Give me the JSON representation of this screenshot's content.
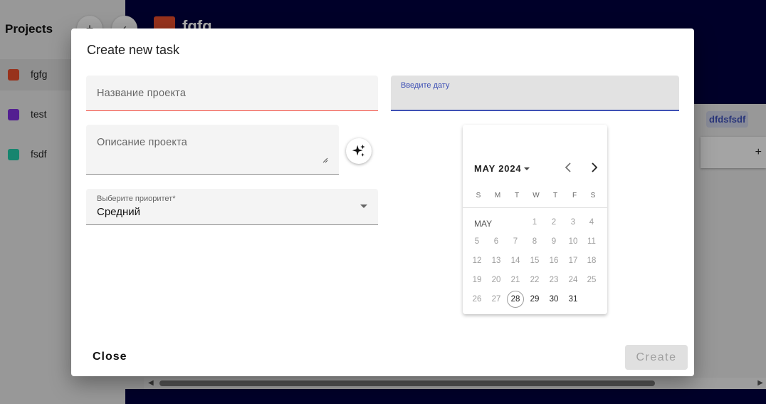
{
  "sidebar": {
    "title": "Projects",
    "add_icon": "+",
    "collapse_icon": "‹",
    "projects": [
      {
        "name": "fgfg",
        "color": "#e04a2a"
      },
      {
        "name": "test",
        "color": "#7b2fd6"
      },
      {
        "name": "fsdf",
        "color": "#23c4a4"
      }
    ]
  },
  "header": {
    "project_name": "fgfg",
    "logo_color": "#e04a2a"
  },
  "board": {
    "column_title": "dfdsfsdf",
    "add_card_icon": "+"
  },
  "dialog": {
    "title": "Create new task",
    "name_field": {
      "placeholder": "Название проекта"
    },
    "description_field": {
      "placeholder": "Описание проекта"
    },
    "ai_icon": "sparkles-icon",
    "priority_field": {
      "label": "Выберите приоритет*",
      "value": "Средний"
    },
    "date_field": {
      "label": "Введите дату"
    },
    "close_label": "Close",
    "create_label": "Create"
  },
  "calendar": {
    "period_label": "MAY 2024",
    "month_label": "MAY",
    "weekdays": [
      "S",
      "M",
      "T",
      "W",
      "T",
      "F",
      "S"
    ],
    "days": [
      "1",
      "2",
      "3",
      "4",
      "5",
      "6",
      "7",
      "8",
      "9",
      "10",
      "11",
      "12",
      "13",
      "14",
      "15",
      "16",
      "17",
      "18",
      "19",
      "20",
      "21",
      "22",
      "23",
      "24",
      "25",
      "26",
      "27",
      "28",
      "29",
      "30",
      "31"
    ],
    "first_day_weekday": 3,
    "today": "28",
    "first_enabled_day": 28
  },
  "colors": {
    "accent": "#3f51b5",
    "error_underline": "#f44336",
    "app_background": "#00003d"
  }
}
